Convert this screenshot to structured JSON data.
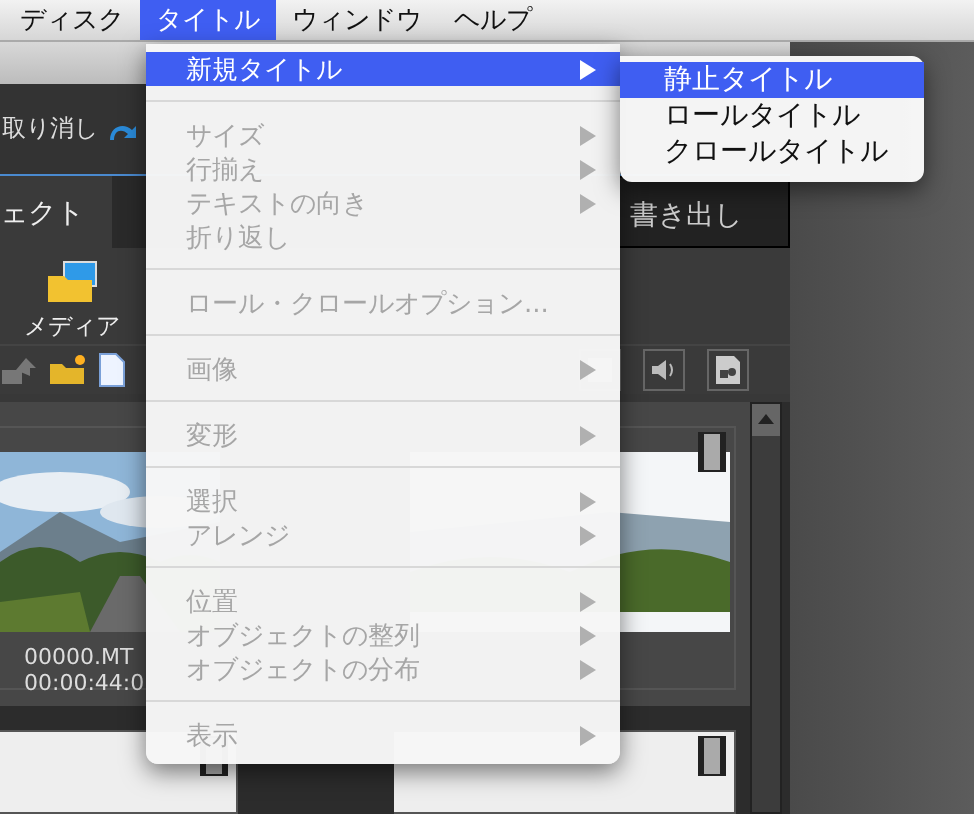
{
  "menubar": [
    {
      "label": "ディスク",
      "selected": false
    },
    {
      "label": "タイトル",
      "selected": true
    },
    {
      "label": "ウィンドウ",
      "selected": false
    },
    {
      "label": "ヘルプ",
      "selected": false
    }
  ],
  "toolbar": {
    "undo": "取り消し"
  },
  "tabs": [
    {
      "label": "ェクト",
      "selected": true
    },
    {
      "label": "書き出し",
      "selected": false
    }
  ],
  "media": {
    "label": "メディア"
  },
  "clips": [
    {
      "name": "00000.MT",
      "duration": "00:00:44:0"
    }
  ],
  "menu": {
    "groups": [
      [
        {
          "label": "新規タイトル",
          "enabled": true,
          "submenu": true,
          "selected": true
        }
      ],
      [
        {
          "label": "サイズ",
          "enabled": false,
          "submenu": true,
          "selected": false
        },
        {
          "label": "行揃え",
          "enabled": false,
          "submenu": true,
          "selected": false
        },
        {
          "label": "テキストの向き",
          "enabled": false,
          "submenu": true,
          "selected": false
        },
        {
          "label": "折り返し",
          "enabled": false,
          "submenu": false,
          "selected": false
        }
      ],
      [
        {
          "label": "ロール・クロールオプション...",
          "enabled": false,
          "submenu": false,
          "selected": false
        }
      ],
      [
        {
          "label": "画像",
          "enabled": false,
          "submenu": true,
          "selected": false
        }
      ],
      [
        {
          "label": "変形",
          "enabled": false,
          "submenu": true,
          "selected": false
        }
      ],
      [
        {
          "label": "選択",
          "enabled": false,
          "submenu": true,
          "selected": false
        },
        {
          "label": "アレンジ",
          "enabled": false,
          "submenu": true,
          "selected": false
        }
      ],
      [
        {
          "label": "位置",
          "enabled": false,
          "submenu": true,
          "selected": false
        },
        {
          "label": "オブジェクトの整列",
          "enabled": false,
          "submenu": true,
          "selected": false
        },
        {
          "label": "オブジェクトの分布",
          "enabled": false,
          "submenu": true,
          "selected": false
        }
      ],
      [
        {
          "label": "表示",
          "enabled": false,
          "submenu": true,
          "selected": false
        }
      ]
    ]
  },
  "submenu": [
    {
      "label": "静止タイトル",
      "selected": true
    },
    {
      "label": "ロールタイトル",
      "selected": false
    },
    {
      "label": "クロールタイトル",
      "selected": false
    }
  ]
}
